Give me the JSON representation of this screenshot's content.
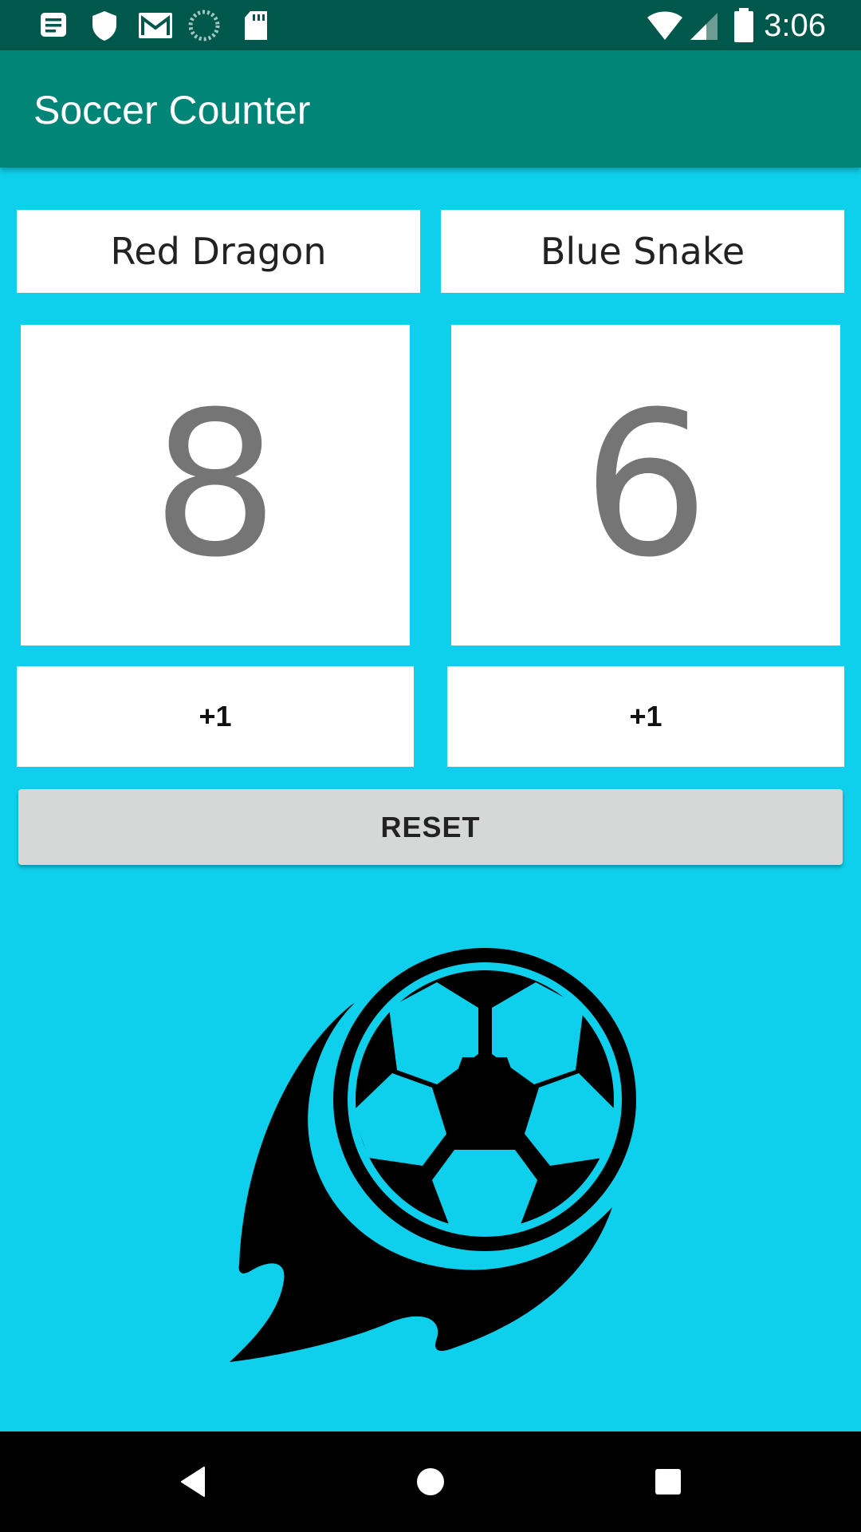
{
  "status_bar": {
    "time": "3:06",
    "left_icons": [
      "notes-icon",
      "shield-icon",
      "gmail-icon",
      "sync-icon",
      "sd-card-icon"
    ],
    "right_icons": [
      "wifi-icon",
      "signal-icon",
      "battery-icon"
    ]
  },
  "app_bar": {
    "title": "Soccer Counter"
  },
  "teams": [
    {
      "name": "Red Dragon",
      "score": "8",
      "add_label": "+1"
    },
    {
      "name": "Blue Snake",
      "score": "6",
      "add_label": "+1"
    }
  ],
  "reset_label": "RESET",
  "illustration": "soccer-ball-flame-icon",
  "nav_bar": {
    "buttons": [
      "back-icon",
      "home-icon",
      "recents-icon"
    ]
  },
  "colors": {
    "status_bar": "#00574b",
    "app_bar": "#008577",
    "background": "#0fd0ec",
    "score_text": "#757575",
    "reset_button": "#d6d7d7"
  }
}
